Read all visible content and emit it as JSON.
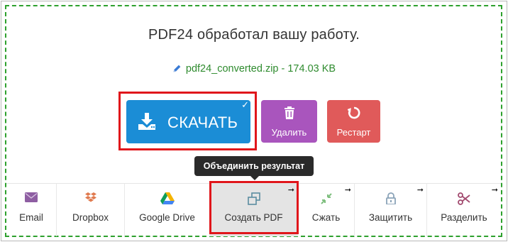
{
  "status": {
    "title": "PDF24 обработал вашу работу.",
    "filename": "pdf24_converted.zip - 174.03 KB"
  },
  "actions": {
    "download_label": "СКАЧАТЬ",
    "delete_label": "Удалить",
    "restart_label": "Рестарт"
  },
  "tooltip": {
    "text": "Объединить результат"
  },
  "tools": [
    {
      "label": "Email",
      "icon": "envelope-icon"
    },
    {
      "label": "Dropbox",
      "icon": "dropbox-icon"
    },
    {
      "label": "Google Drive",
      "icon": "google-drive-icon"
    },
    {
      "label": "Создать PDF",
      "icon": "create-pdf-icon"
    },
    {
      "label": "Сжать",
      "icon": "compress-icon"
    },
    {
      "label": "Защитить",
      "icon": "lock-icon"
    },
    {
      "label": "Разделить",
      "icon": "scissors-icon"
    }
  ],
  "colors": {
    "accent_green": "#2ea12e",
    "download_blue": "#1b8dd6",
    "delete_purple": "#a955bd",
    "restart_red": "#e05a5a",
    "highlight_red": "#e0161b"
  }
}
